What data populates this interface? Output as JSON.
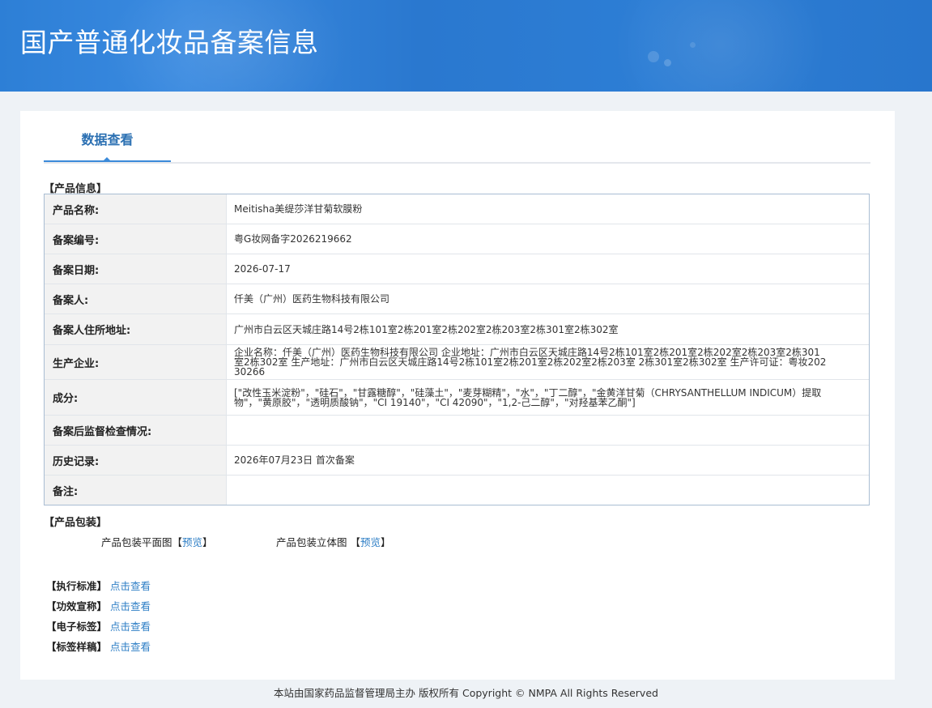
{
  "header": {
    "title": "国产普通化妆品备案信息"
  },
  "tab": {
    "label": "数据查看"
  },
  "product_info": {
    "section_title": "【产品信息】",
    "rows": [
      {
        "label": "产品名称:",
        "value": "Meitisha美缇莎洋甘菊软膜粉"
      },
      {
        "label": "备案编号:",
        "value": "粤G妆网备字2026219662"
      },
      {
        "label": "备案日期:",
        "value": "2026-07-17"
      },
      {
        "label": "备案人:",
        "value": "仟美（广州）医药生物科技有限公司"
      },
      {
        "label": "备案人住所地址:",
        "value": "广州市白云区天城庄路14号2栋101室2栋201室2栋202室2栋203室2栋301室2栋302室"
      },
      {
        "label": "生产企业:",
        "value": "企业名称：仟美（广州）医药生物科技有限公司 企业地址：广州市白云区天城庄路14号2栋101室2栋201室2栋202室2栋203室2栋301室2栋302室 生产地址：广州市白云区天城庄路14号2栋101室2栋201室2栋202室2栋203室 2栋301室2栋302室 生产许可证：粤妆20230266"
      },
      {
        "label": "成分:",
        "value": "[\"改性玉米淀粉\"，\"硅石\"，\"甘露糖醇\"，\"硅藻土\"，\"麦芽糊精\"，\"水\"，\"丁二醇\"，\"金黄洋甘菊（CHRYSANTHELLUM INDICUM）提取物\"，\"黄原胶\"，\"透明质酸钠\"，\"CI 19140\"，\"CI 42090\"，\"1,2-己二醇\"，\"对羟基苯乙酮\"]"
      },
      {
        "label": "备案后监督检查情况:",
        "value": ""
      },
      {
        "label": "历史记录:",
        "value": "2026年07月23日 首次备案"
      },
      {
        "label": "备注:",
        "value": ""
      }
    ]
  },
  "packaging": {
    "section_title": "【产品包装】",
    "flat_label": "产品包装平面图",
    "solid_label": "产品包装立体图",
    "bracket_open": "【",
    "bracket_close": "】",
    "preview_text": "预览"
  },
  "links": [
    {
      "label": "【执行标准】",
      "link": "点击查看"
    },
    {
      "label": "【功效宣称】",
      "link": "点击查看"
    },
    {
      "label": "【电子标签】",
      "link": "点击查看"
    },
    {
      "label": "【标签样稿】",
      "link": "点击查看"
    }
  ],
  "footer": {
    "text": "本站由国家药品监督管理局主办 版权所有 Copyright © NMPA All Rights Reserved"
  }
}
